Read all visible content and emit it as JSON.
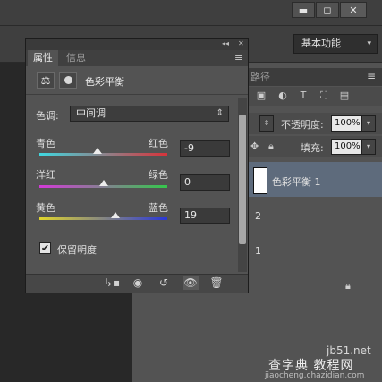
{
  "window_controls": {
    "minimize": "▬",
    "maximize": "◻",
    "close": "✕"
  },
  "workspace": {
    "label": "基本功能",
    "chevron": "▾"
  },
  "properties_panel": {
    "collapse_glyph": "◂◂",
    "close_glyph": "✕",
    "menu_glyph": "≡",
    "tabs": [
      "属性",
      "信息"
    ],
    "title": "色彩平衡",
    "preset_label": "色调:",
    "preset_value": "中间调",
    "preset_chevron": "⇕",
    "sliders": [
      {
        "left": "青色",
        "right": "红色",
        "value": "-9",
        "level": -9
      },
      {
        "left": "洋红",
        "right": "绿色",
        "value": "0",
        "level": 0
      },
      {
        "left": "黄色",
        "right": "蓝色",
        "value": "19",
        "level": 19
      }
    ],
    "preserve_luminosity_label": "保留明度",
    "preserve_luminosity_checked": "✔",
    "bottom_icons": [
      "clip-to-layer-icon",
      "view-previous-icon",
      "reset-icon",
      "visibility-icon",
      "trash-icon"
    ]
  },
  "layers_panel": {
    "tab_label": "路径",
    "menu_glyph": "≡",
    "opacity_label": "不透明度:",
    "opacity_value": "100%",
    "fill_label": "填充:",
    "fill_value": "100%",
    "layers": [
      {
        "name": "色彩平衡 1"
      },
      {
        "name": "2"
      },
      {
        "name": "1"
      }
    ]
  },
  "watermark": {
    "line1": "jb51.net",
    "line2": "查字典 教程网",
    "line3": "jiaocheng.chazidian.com"
  },
  "colors": {
    "cyan_red_track": [
      "#3fd7e0",
      "#d8333a"
    ],
    "magenta_green_track": [
      "#d43ad8",
      "#34c74b"
    ],
    "yellow_blue_track": [
      "#e0d52c",
      "#2a37d8"
    ]
  }
}
